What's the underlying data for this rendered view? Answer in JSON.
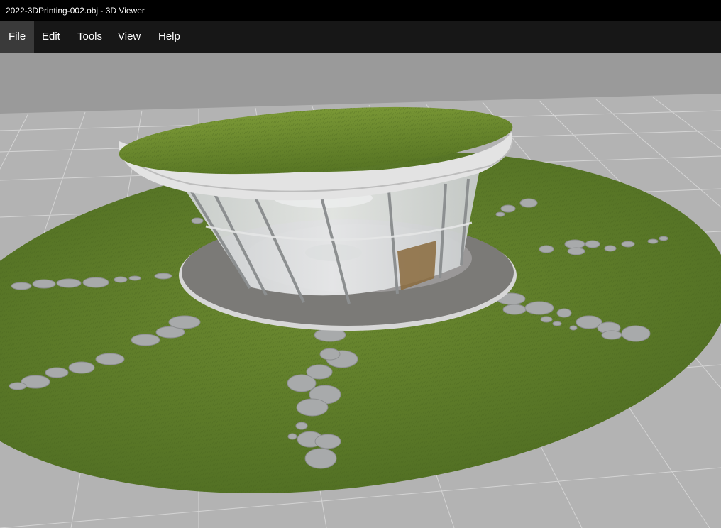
{
  "window": {
    "title": "2022-3DPrinting-002.obj - 3D Viewer"
  },
  "menu": {
    "items": [
      {
        "label": "File",
        "active": true
      },
      {
        "label": "Edit",
        "active": false
      },
      {
        "label": "Tools",
        "active": false
      },
      {
        "label": "View",
        "active": false
      },
      {
        "label": "Help",
        "active": false
      }
    ]
  },
  "scene": {
    "model": "circular glass pavilion with green roof on lawn with stepping stones",
    "colors": {
      "background": "#9a9a9a",
      "grid_floor": "#b4b4b4",
      "grid_lines": "#d2d2d2",
      "lawn": "#5a7a2a",
      "roof_grass": "#6b8a2e",
      "roof_rim": "#e6e6e6",
      "glass": "#d9dbdc",
      "paving": "#7d7b78",
      "stone": "#a7a9aa",
      "wood_floor": "#8a6a3c"
    }
  }
}
